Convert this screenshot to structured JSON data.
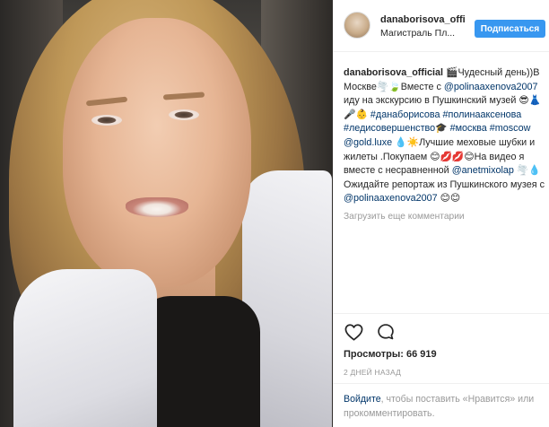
{
  "header": {
    "username": "danaborisova_offi",
    "location": "Магистраль Пл...",
    "follow_label": "Подписаться"
  },
  "caption": {
    "username": "danaborisova_official",
    "t1": " 🎬Чудесный день))В Москве🌪️🍃Вместе с ",
    "mention1": "@polinaaxenova2007",
    "t2": " иду на экскурсию в Пушкинский музей 😎👗🎤👶",
    "hashtags": "#данаборисова #полинааксенова #ледисовершенство",
    "t3": "🎓 ",
    "hashtag2": "#москва #moscow",
    "t4": " ",
    "mention2": "@gold.luxe",
    "t5": " 💧☀️Лучшие меховые шубки и жилеты .Покупаем 😊💋💋😊На видео я вместе с несравненной ",
    "mention3": "@anetmixolap",
    "t6": " 🌪️💧 Ожидайте репортаж из Пушкинского музея с ",
    "mention4": "@polinaaxenova2007",
    "t7": " 😊😊"
  },
  "load_more_label": "Загрузить еще комментарии",
  "stats": {
    "views_label": "Просмотры:",
    "views_count": "66 919",
    "date": "2 ДНЕЙ НАЗАД"
  },
  "login_prompt": {
    "login_link": "Войдите",
    "rest": ", чтобы поставить «Нравится» или прокомментировать."
  },
  "icons": {
    "like": "heart-icon",
    "comment": "comment-icon"
  },
  "colors": {
    "accent": "#3897f0",
    "link": "#003569",
    "muted": "#999999",
    "text": "#262626"
  }
}
